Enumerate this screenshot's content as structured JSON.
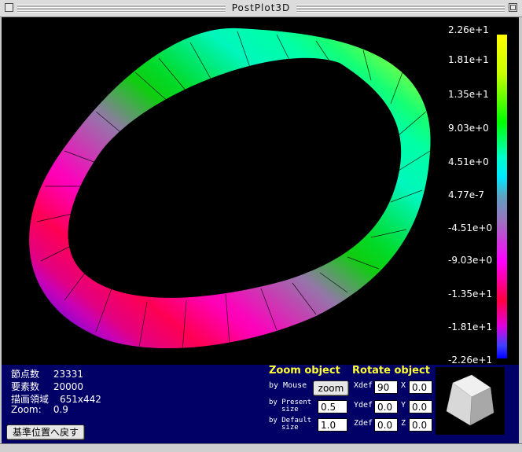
{
  "window": {
    "title": "PostPlot3D"
  },
  "legend": {
    "labels": [
      "2.26e+1",
      "1.81e+1",
      "1.35e+1",
      "9.03e+0",
      "4.51e+0",
      "4.77e-7",
      "-4.51e+0",
      "-9.03e+0",
      "-1.35e+1",
      "-1.81e+1",
      "-2.26e+1"
    ],
    "colors": [
      "#ffff00",
      "#c8ff00",
      "#00ff00",
      "#00ffcc",
      "#00e8ff",
      "#5fa0c0",
      "#a070c0",
      "#ff00ff",
      "#ff0040",
      "#e000e0",
      "#0000ff"
    ]
  },
  "info": {
    "nodes_label": "節点数",
    "nodes_value": "23331",
    "elements_label": "要素数",
    "elements_value": "20000",
    "area_label": "描画領域",
    "area_value": "651x442",
    "zoom_label": "Zoom:",
    "zoom_value": "0.9"
  },
  "reset_button": "基準位置へ戻す",
  "zoom": {
    "heading": "Zoom object",
    "by_mouse": "by Mouse",
    "zoom_button": "zoom",
    "by_present_1": "by Present",
    "by_present_2": "size",
    "present_value": "0.5",
    "by_default_1": "by Default",
    "by_default_2": "size",
    "default_value": "1.0"
  },
  "rotate": {
    "heading": "Rotate object",
    "xdef_label": "Xdef",
    "xdef_value": "90",
    "ydef_label": "Ydef",
    "ydef_value": "0.0",
    "zdef_label": "Zdef",
    "zdef_value": "0.0",
    "x_label": "X",
    "x_value": "0.0",
    "y_label": "Y",
    "y_value": "0.0",
    "z_label": "Z",
    "z_value": "0.0"
  }
}
